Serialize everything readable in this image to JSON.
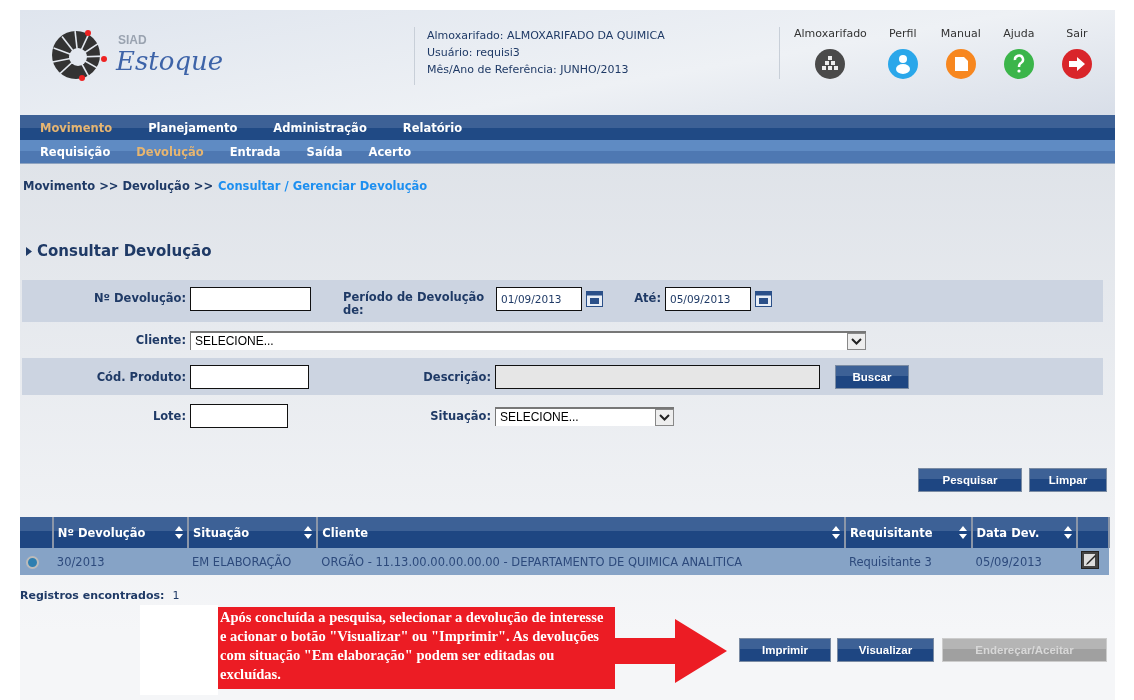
{
  "header": {
    "logo": {
      "brand_small": "SIAD",
      "brand": "Estoque"
    },
    "info": [
      "Almoxarifado: ALMOXARIFADO DA QUIMICA",
      "Usuário: requisi3",
      "Mês/Ano de Referência: JUNHO/2013"
    ],
    "shortcuts": [
      {
        "label": "Almoxarifado",
        "kind": "stock"
      },
      {
        "label": "Perfil",
        "kind": "profile"
      },
      {
        "label": "Manual",
        "kind": "manual"
      },
      {
        "label": "Ajuda",
        "kind": "help"
      },
      {
        "label": "Sair",
        "kind": "exit"
      }
    ]
  },
  "menu": [
    {
      "label": "Movimento",
      "selected": true
    },
    {
      "label": "Planejamento",
      "selected": false
    },
    {
      "label": "Administração",
      "selected": false
    },
    {
      "label": "Relatório",
      "selected": false
    }
  ],
  "submenu": [
    {
      "label": "Requisição",
      "selected": false
    },
    {
      "label": "Devolução",
      "selected": true
    },
    {
      "label": "Entrada",
      "selected": false
    },
    {
      "label": "Saída",
      "selected": false
    },
    {
      "label": "Acerto",
      "selected": false
    }
  ],
  "breadcrumb": {
    "path": "Movimento >> Devolução >>",
    "current": "Consultar / Gerenciar Devolução"
  },
  "section_title": "Consultar Devolução",
  "form": {
    "numero_devolucao": {
      "label": "Nº Devolução:"
    },
    "periodo_de": {
      "label": "Período de Devolução de:",
      "value": "01/09/2013"
    },
    "ate": {
      "label": "Até:",
      "value": "05/09/2013"
    },
    "cliente": {
      "label": "Cliente:",
      "value": "SELECIONE..."
    },
    "cod_produto": {
      "label": "Cód. Produto:"
    },
    "descricao": {
      "label": "Descrição:",
      "disabled": true
    },
    "buscar_button": "Buscar",
    "lote": {
      "label": "Lote:"
    },
    "situacao": {
      "label": "Situação:",
      "value": "SELECIONE..."
    }
  },
  "search_buttons": [
    "Pesquisar",
    "Limpar"
  ],
  "table": {
    "columns": [
      {
        "label": "Nº Devolução",
        "sortable": true
      },
      {
        "label": "Situação",
        "sortable": true
      },
      {
        "label": "Cliente",
        "sortable": true
      },
      {
        "label": "Requisitante",
        "sortable": true
      },
      {
        "label": "Data Dev.",
        "sortable": true
      }
    ],
    "rows": [
      {
        "selected": true,
        "cells": [
          "30/2013",
          "EM ELABORAÇÃO",
          "ORGÃO - 11.13.00.00.00.00.00 - DEPARTAMENTO DE QUIMICA ANALITICA",
          "Requisitante 3",
          "05/09/2013"
        ]
      }
    ]
  },
  "records": {
    "label": "Registros encontrados:",
    "count": "1"
  },
  "annotation": "Após concluída a pesquisa, selecionar a devolução de interesse e acionar o botão \"Visualizar\" ou \"Imprimir\". As devoluções com situação \"Em elaboração\" podem ser editadas ou excluídas.",
  "action_buttons": [
    {
      "label": "Imprimir",
      "disabled": false
    },
    {
      "label": "Visualizar",
      "disabled": false
    },
    {
      "label": "Endereçar/Aceitar",
      "disabled": true
    }
  ]
}
